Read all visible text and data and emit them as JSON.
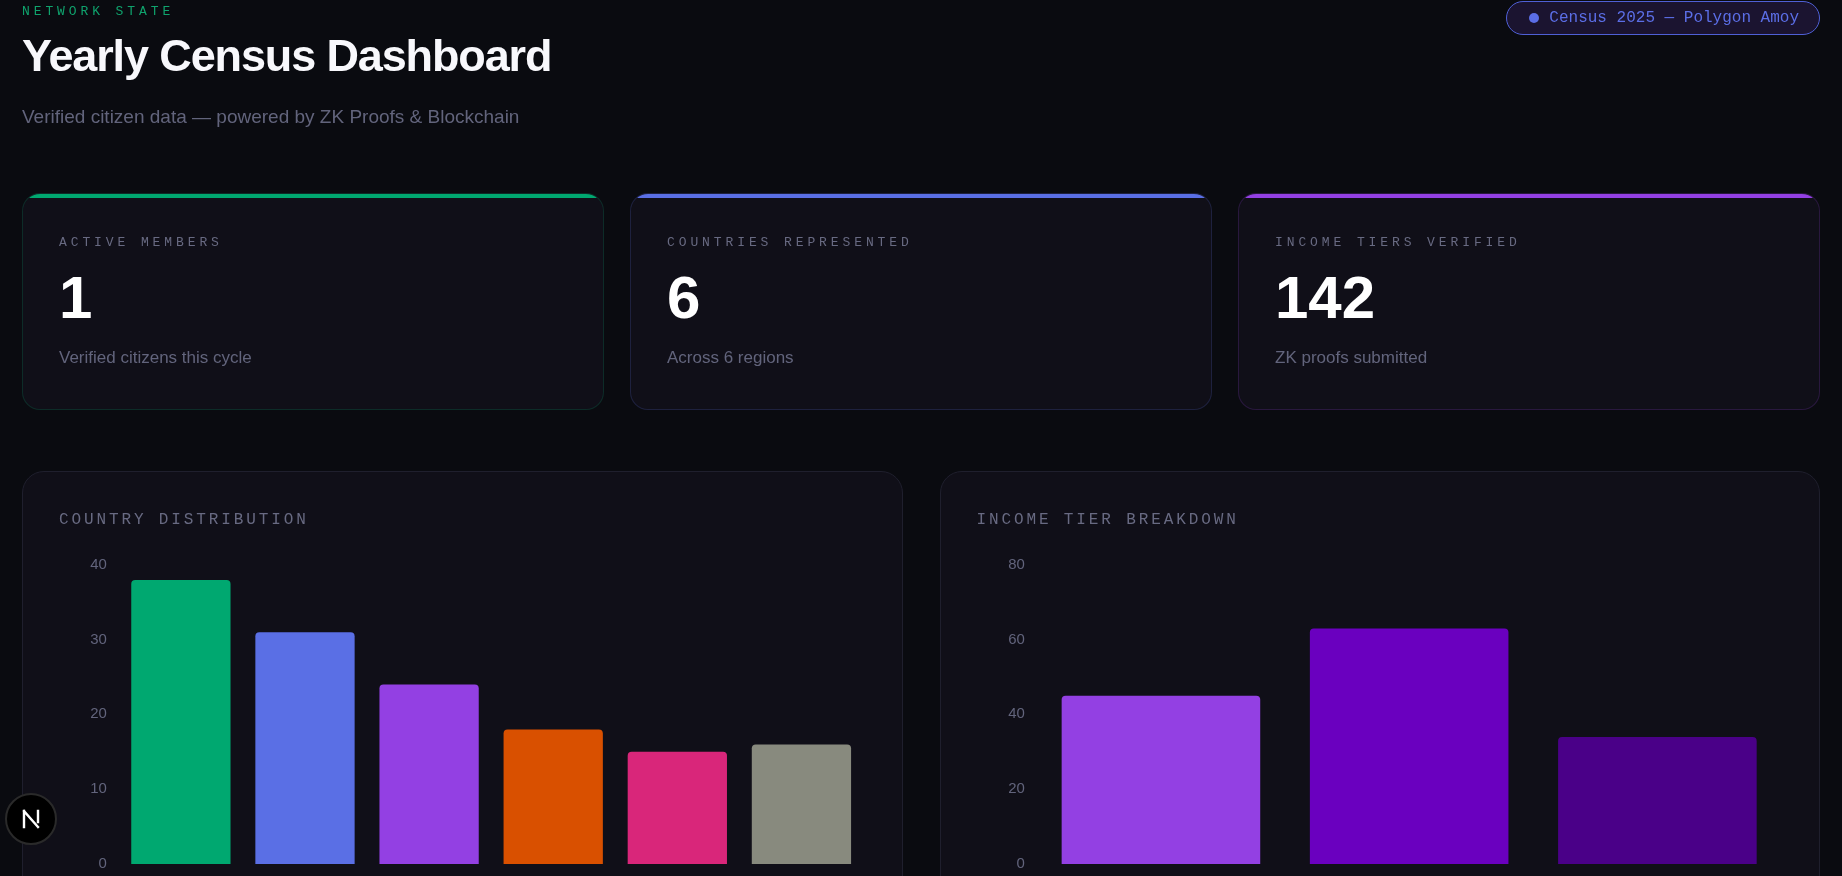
{
  "header": {
    "eyebrow": "NETWORK STATE",
    "title": "Yearly Census Dashboard",
    "subtitle": "Verified citizen data — powered by ZK Proofs & Blockchain",
    "badge": "Census 2025 — Polygon Amoy"
  },
  "stats": [
    {
      "label": "ACTIVE MEMBERS",
      "value": "1",
      "caption": "Verified citizens this cycle",
      "color": "#00a870"
    },
    {
      "label": "COUNTRIES REPRESENTED",
      "value": "6",
      "caption": "Across 6 regions",
      "color": "#5a6fe5"
    },
    {
      "label": "INCOME TIERS VERIFIED",
      "value": "142",
      "caption": "ZK proofs submitted",
      "color": "#9340e3"
    }
  ],
  "charts": [
    {
      "chart_data": {
        "type": "bar",
        "title": "COUNTRY DISTRIBUTION",
        "ylim": [
          0,
          40
        ],
        "yticks": [
          0,
          10,
          20,
          30,
          40
        ],
        "values": [
          38,
          31,
          24,
          18,
          15,
          16
        ],
        "colors": [
          "#00a870",
          "#5a6fe5",
          "#9340e3",
          "#d95000",
          "#d9267a",
          "#888a7e"
        ]
      }
    },
    {
      "chart_data": {
        "type": "bar",
        "title": "INCOME TIER BREAKDOWN",
        "ylim": [
          0,
          80
        ],
        "yticks": [
          0,
          20,
          40,
          60,
          80
        ],
        "values": [
          45,
          63,
          34
        ],
        "colors": [
          "#9340e3",
          "#6a00bf",
          "#4a0088"
        ]
      }
    }
  ]
}
